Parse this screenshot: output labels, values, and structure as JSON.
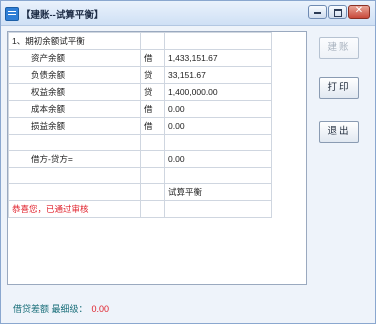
{
  "window": {
    "title": "【建账--试算平衡】"
  },
  "table": {
    "rows": [
      {
        "name": "1、期初余额试平衡",
        "dc": "",
        "amount": ""
      },
      {
        "name": "资产余额",
        "dc": "借",
        "amount": "1,433,151.67"
      },
      {
        "name": "负债余额",
        "dc": "贷",
        "amount": "33,151.67"
      },
      {
        "name": "权益余额",
        "dc": "贷",
        "amount": "1,400,000.00"
      },
      {
        "name": "成本余额",
        "dc": "借",
        "amount": "0.00"
      },
      {
        "name": "损益余额",
        "dc": "借",
        "amount": "0.00"
      },
      {
        "name": "",
        "dc": "",
        "amount": ""
      },
      {
        "name": "借方-贷方=",
        "dc": "",
        "amount": "0.00"
      },
      {
        "name": "",
        "dc": "",
        "amount": ""
      },
      {
        "name": "",
        "dc": "",
        "amount": "试算平衡"
      },
      {
        "name": "恭喜您，已通过审核",
        "dc": "",
        "amount": ""
      }
    ]
  },
  "buttons": {
    "create_account": "建账",
    "print": "打印",
    "exit": "退出"
  },
  "status": {
    "label": "借贷差额  最细级：",
    "value": "0.00"
  }
}
